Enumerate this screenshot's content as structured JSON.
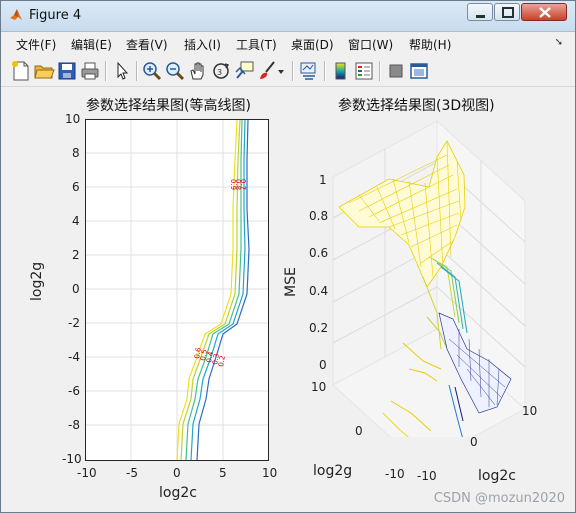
{
  "window": {
    "title": "Figure 4",
    "controls": {
      "minimize": "minimize",
      "maximize": "maximize",
      "close": "close"
    }
  },
  "menu": [
    "文件(F)",
    "编辑(E)",
    "查看(V)",
    "插入(I)",
    "工具(T)",
    "桌面(D)",
    "窗口(W)",
    "帮助(H)"
  ],
  "toolbar_icons": [
    "new-figure-icon",
    "open-file-icon",
    "save-icon",
    "print-icon",
    "pointer-icon",
    "zoom-in-icon",
    "zoom-out-icon",
    "pan-hand-icon",
    "rotate-3d-icon",
    "data-cursor-icon",
    "brush-icon",
    "link-plot-icon",
    "colorbar-icon",
    "legend-icon",
    "hide-plot-tools-icon",
    "show-plot-tools-icon"
  ],
  "contour_plot": {
    "title": "参数选择结果图(等高线图)",
    "xlabel": "log2c",
    "ylabel": "log2g",
    "xticks": [
      "-10",
      "-5",
      "0",
      "5",
      "10"
    ],
    "yticks": [
      "10",
      "8",
      "6",
      "4",
      "2",
      "0",
      "-2",
      "-4",
      "-6",
      "-8",
      "-10"
    ],
    "labels": [
      "0.2",
      "0.3",
      "0.4",
      "0.5",
      "0.6",
      "0.7",
      "0.8",
      "0.9"
    ]
  },
  "surface_plot": {
    "title": "参数选择结果图(3D视图)",
    "zlabel": "MSE",
    "xlabel": "log2c",
    "ylabel": "log2g",
    "zticks": [
      "1",
      "0.8",
      "0.6",
      "0.4",
      "0.2",
      "0"
    ],
    "xticks": [
      "-10",
      "0",
      "10"
    ],
    "yticks": [
      "10",
      "0",
      "-10"
    ]
  },
  "watermark": "CSDN @mozun2020",
  "colors": {
    "accent_red": "#e00000",
    "yellow": "#f0e000",
    "blue": "#1a5fb4",
    "navy": "#1b1b7a"
  }
}
